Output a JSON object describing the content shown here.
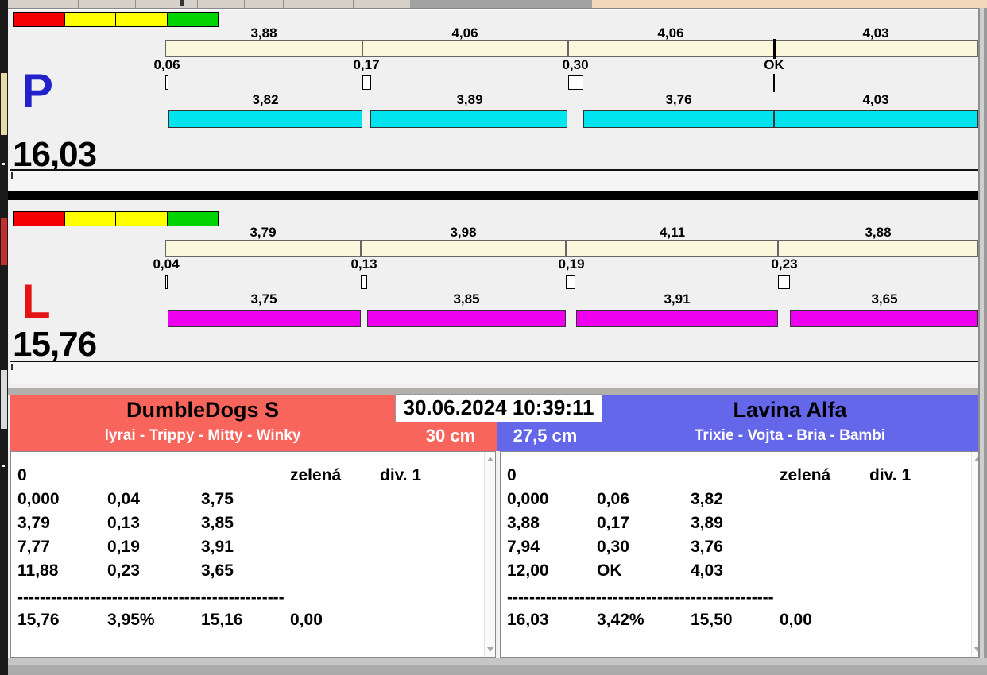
{
  "datetime": "30.06.2024 10:39:11",
  "lanes": [
    {
      "id": "P",
      "letter": "P",
      "letter_color": "#2222CC",
      "bar_color": "#00E4F0",
      "total_label": "16,03",
      "total_seconds": 16.03,
      "traffic_lights": [
        "#F40000",
        "#FFFF00",
        "#FFFF00",
        "#00D300"
      ],
      "segments": [
        {
          "split_label": "3,88",
          "split": 3.88,
          "gap_label": "0,06",
          "gap": 0.06,
          "dog_label": "3,82",
          "dog": 3.82
        },
        {
          "split_label": "4,06",
          "split": 4.06,
          "gap_label": "0,17",
          "gap": 0.17,
          "dog_label": "3,89",
          "dog": 3.89
        },
        {
          "split_label": "4,06",
          "split": 4.06,
          "gap_label": "0,30",
          "gap": 0.3,
          "dog_label": "3,76",
          "dog": 3.76
        },
        {
          "split_label": "4,03",
          "split": 4.03,
          "gap_label": "OK",
          "gap": 0,
          "dog_label": "4,03",
          "dog": 4.03
        }
      ]
    },
    {
      "id": "L",
      "letter": "L",
      "letter_color": "#E41414",
      "bar_color": "#EE00EE",
      "total_label": "15,76",
      "total_seconds": 15.76,
      "traffic_lights": [
        "#F40000",
        "#FFFF00",
        "#FFFF00",
        "#00D300"
      ],
      "segments": [
        {
          "split_label": "3,79",
          "split": 3.79,
          "gap_label": "0,04",
          "gap": 0.04,
          "dog_label": "3,75",
          "dog": 3.75
        },
        {
          "split_label": "3,98",
          "split": 3.98,
          "gap_label": "0,13",
          "gap": 0.13,
          "dog_label": "3,85",
          "dog": 3.85
        },
        {
          "split_label": "4,11",
          "split": 4.11,
          "gap_label": "0,19",
          "gap": 0.19,
          "dog_label": "3,91",
          "dog": 3.91
        },
        {
          "split_label": "3,88",
          "split": 3.88,
          "gap_label": "0,23",
          "gap": 0.23,
          "dog_label": "3,65",
          "dog": 3.65
        }
      ]
    }
  ],
  "teams": [
    {
      "name": "DumbleDogs S",
      "dogs": "lyrai - Trippy - Mitty - Winky",
      "jump_height": "30 cm",
      "header_color": "#F8655C",
      "status_row": {
        "faults": "0",
        "color": "zelená",
        "division": "div. 1"
      },
      "rows": [
        [
          "0,000",
          "0,04",
          "3,75"
        ],
        [
          "3,79",
          "0,13",
          "3,85"
        ],
        [
          "7,77",
          "0,19",
          "3,91"
        ],
        [
          "11,88",
          "0,23",
          "3,65"
        ]
      ],
      "separator": "------------------------------------------------",
      "totals": [
        "15,76",
        "3,95%",
        "15,16",
        "0,00"
      ]
    },
    {
      "name": "Lavina Alfa",
      "dogs": "Trixie - Vojta - Bria - Bambi",
      "jump_height": "27,5 cm",
      "header_color": "#6467E9",
      "status_row": {
        "faults": "0",
        "color": "zelená",
        "division": "div. 1"
      },
      "rows": [
        [
          "0,000",
          "0,06",
          "3,82"
        ],
        [
          "3,88",
          "0,17",
          "3,89"
        ],
        [
          "7,94",
          "0,30",
          "3,76"
        ],
        [
          "12,00",
          "OK",
          "4,03"
        ]
      ],
      "separator": "------------------------------------------------",
      "totals": [
        "16,03",
        "3,42%",
        "15,50",
        "0,00"
      ]
    }
  ]
}
